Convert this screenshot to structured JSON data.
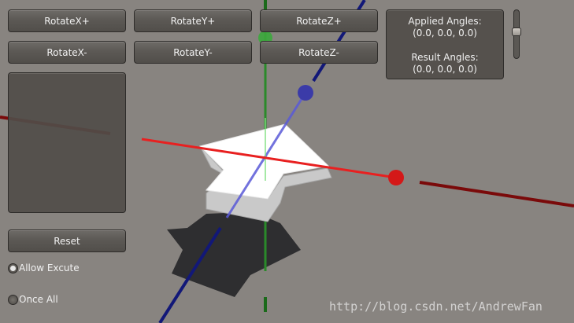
{
  "toolbar": {
    "rotate_x_plus": "RotateX+",
    "rotate_y_plus": "RotateY+",
    "rotate_z_plus": "RotateZ+",
    "rotate_x_minus": "RotateX-",
    "rotate_y_minus": "RotateY-",
    "rotate_z_minus": "RotateZ-"
  },
  "angles": {
    "applied_title": "Applied Angles:",
    "applied_value": "(0.0, 0.0, 0.0)",
    "result_title": "Result Angles:",
    "result_value": "(0.0, 0.0, 0.0)"
  },
  "controls": {
    "reset_label": "Reset",
    "allow_execute_label": "Allow Excute",
    "allow_execute_checked": true,
    "once_all_label": "Once All",
    "once_all_checked": false,
    "slider_level": 0.45
  },
  "watermark": "http://blog.csdn.net/AndrewFan",
  "colors": {
    "background": "#888480",
    "x_axis": "#e82020",
    "x_axis_dark": "#7a0a0a",
    "y_axis": "#2a8a2a",
    "y_axis_light": "#80e080",
    "z_axis": "#121878",
    "z_axis_light": "#5a5ad8",
    "object": "#ffffff",
    "shadow": "#2e2e30"
  },
  "icons": {
    "x_handle": "red-sphere",
    "y_handle": "green-sphere",
    "z_handle": "blue-sphere"
  }
}
